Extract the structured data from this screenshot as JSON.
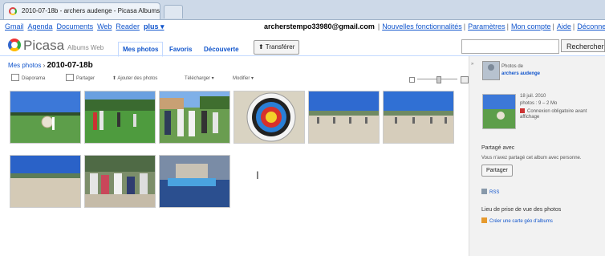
{
  "browser": {
    "tab_title": "2010-07-18b - archers audenge - Picasa Albums Web"
  },
  "google_bar": {
    "left_links": [
      "Gmail",
      "Agenda",
      "Documents",
      "Web",
      "Reader",
      "plus ▾"
    ],
    "email": "archerstempo33980@gmail.com",
    "sep": "|",
    "right_links": [
      "Nouvelles fonctionnalités",
      "Paramètres",
      "Mon compte",
      "Aide",
      "Déconnexion"
    ]
  },
  "header": {
    "logo": "Picasa",
    "logo_sub": "Albums Web",
    "tabs": [
      "Mes photos",
      "Favoris",
      "Découverte"
    ],
    "upload": "Transférer",
    "search_button": "Rechercher"
  },
  "breadcrumb": {
    "root": "Mes photos",
    "separator": " › ",
    "album": "2010-07-18b"
  },
  "toolbar": {
    "diaporama": "Diaporama",
    "partager": "Partager",
    "ajouter": "Ajouter des photos",
    "telecharger": "Télécharger ▾",
    "modifier": "Modifier ▾"
  },
  "sidebar": {
    "photos_de_label": "Photos de",
    "owner": "archers audenge",
    "date": "18 juil. 2010",
    "photo_info": "photos : 9 – 2 Mo",
    "auth_line1": "Connexion obligatoire avant",
    "auth_line2": "affichage",
    "shared_title": "Partagé avec",
    "shared_text": "Vous n'avez partagé cet album avec personne.",
    "share_button": "Partager",
    "rss": "RSS",
    "location_title": "Lieu de prise de vue des photos",
    "location_link": "Créer une carte géo d'albums"
  },
  "photos": [
    {
      "name": "archer-field"
    },
    {
      "name": "archers-group-field"
    },
    {
      "name": "archers-standing-group"
    },
    {
      "name": "archery-target"
    },
    {
      "name": "beach-line-1"
    },
    {
      "name": "beach-line-2"
    },
    {
      "name": "beach-sky"
    },
    {
      "name": "crowd-blurry"
    },
    {
      "name": "water-boat-blurry"
    }
  ],
  "colors": {
    "link": "#1155cc",
    "sky": "#2f6ad0",
    "grass": "#5d9e4a",
    "sand": "#d8d0bf"
  }
}
